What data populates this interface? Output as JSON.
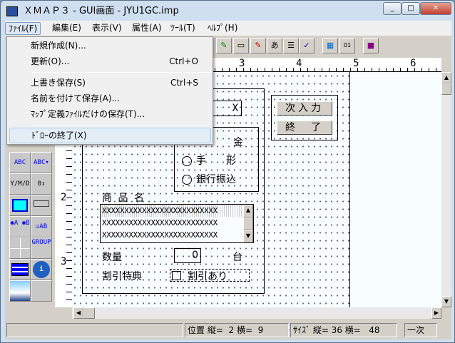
{
  "window": {
    "title": "ＸＭＡＰ３ - GUI画面 - JYU1GC.imp",
    "controls": {
      "minimize": "_",
      "maximize": "□",
      "close": "✕"
    }
  },
  "menubar": [
    {
      "label": "ﾌｧｲﾙ(F)",
      "active": true
    },
    {
      "label": "編集(E)"
    },
    {
      "label": "表示(V)"
    },
    {
      "label": "属性(A)"
    },
    {
      "label": "ﾂｰﾙ(T)"
    },
    {
      "label": "ﾍﾙﾌﾟ(H)"
    }
  ],
  "file_menu": {
    "items": [
      {
        "label": "新規作成(N)...",
        "shortcut": ""
      },
      {
        "label": "更新(O)...",
        "shortcut": "Ctrl+O"
      },
      {
        "label": "上書き保存(S)",
        "shortcut": "Ctrl+S"
      },
      {
        "label": "名前を付けて保存(A)...",
        "shortcut": ""
      },
      {
        "label": "ﾏｯﾌﾟ定義ﾌｧｲﾙだけの保存(T)...",
        "shortcut": ""
      },
      {
        "label": "ﾄﾞﾛｰの終了(X)",
        "shortcut": "",
        "highlighted": true
      }
    ]
  },
  "toolbar": {
    "icons": [
      "pencil-icon",
      "window-pencil-icon",
      "multi-pencil-icon",
      "text-pencil-icon",
      "lines-pencil-icon",
      "check-pencil-icon",
      "screen-export-icon",
      "numbered-list-icon",
      "help-book-icon"
    ]
  },
  "ruler": {
    "h_labels": [
      "3",
      "4",
      "5",
      "6"
    ],
    "v_labels": [
      "2",
      "3"
    ]
  },
  "toolbox": [
    "ABC",
    "ABC▾",
    "Y/M/D",
    "0⇕",
    "panel",
    "buttons",
    "◉A ◉B",
    "☑AB",
    "grid",
    "GROUP",
    "list",
    "info",
    "image",
    ""
  ],
  "form": {
    "field_x": "X",
    "radio_group": {
      "partial_label": "金",
      "options": [
        "手　　形",
        "銀行振込"
      ]
    },
    "buttons": [
      "次入力",
      "終　了"
    ],
    "product_label": "商 品 名",
    "list_rows": [
      "XXXXXXXXXXXXXXXXXXXXXXXXXX",
      "XXXXXXXXXXXXXXXXXXXXXXXXXX",
      "XXXXXXXXXXXXXXXXXXXXXXXXXX"
    ],
    "qty_label": "数量",
    "qty_value": "0",
    "qty_unit": "台",
    "discount_label": "割引特典",
    "discount_checkbox": "割引あり"
  },
  "status": {
    "position": "位置 縦=  2 横=  9",
    "size": "ｻｲｽﾞ 縦= 36 横=   48",
    "mode": "一次"
  }
}
